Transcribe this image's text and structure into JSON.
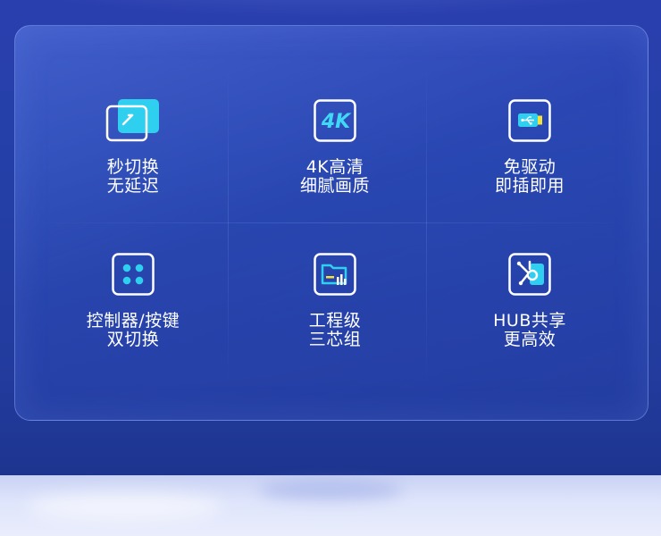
{
  "features": [
    {
      "line1": "秒切换",
      "line2": "无延迟",
      "icon": "switch-icon"
    },
    {
      "line1": "4K高清",
      "line2": "细腻画质",
      "icon": "4k-icon",
      "icon_text": "4K"
    },
    {
      "line1": "免驱动",
      "line2": "即插即用",
      "icon": "usb-icon"
    },
    {
      "line1": "控制器/按键",
      "line2": "双切换",
      "icon": "controller-icon"
    },
    {
      "line1": "工程级",
      "line2": "三芯组",
      "icon": "folder-chart-icon"
    },
    {
      "line1": "HUB共享",
      "line2": "更高效",
      "icon": "hub-share-icon"
    }
  ],
  "colors": {
    "accent": "#3fd8f6",
    "accent_fill": "#2fcff0",
    "yellow": "#f2e23a",
    "outline": "#ffffff"
  }
}
